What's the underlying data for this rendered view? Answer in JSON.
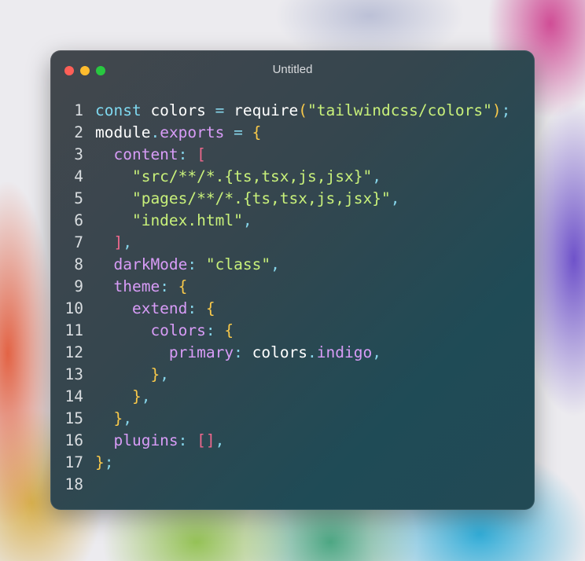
{
  "window": {
    "title": "Untitled",
    "controls": [
      "close-icon",
      "minimize-icon",
      "zoom-icon"
    ]
  },
  "colors": {
    "keyword": "#7fd9f0",
    "identifier": "#ffffff",
    "property": "#d89cf7",
    "punctuation": "#86d5ea",
    "brace": "#f9c94a",
    "bracket": "#f0688d",
    "string": "#c8f07a"
  },
  "code": {
    "lines": [
      {
        "num": "1",
        "tokens": [
          {
            "t": "const",
            "k": "kw"
          },
          {
            "t": " colors ",
            "k": "id"
          },
          {
            "t": "=",
            "k": "pc"
          },
          {
            "t": " require",
            "k": "id"
          },
          {
            "t": "(",
            "k": "br"
          },
          {
            "t": "\"tailwindcss/colors\"",
            "k": "st"
          },
          {
            "t": ")",
            "k": "br"
          },
          {
            "t": ";",
            "k": "pc"
          }
        ]
      },
      {
        "num": "2",
        "tokens": [
          {
            "t": "module",
            "k": "id"
          },
          {
            "t": ".",
            "k": "pc"
          },
          {
            "t": "exports",
            "k": "pr"
          },
          {
            "t": " = ",
            "k": "pc"
          },
          {
            "t": "{",
            "k": "br"
          }
        ]
      },
      {
        "num": "3",
        "tokens": [
          {
            "t": "  content",
            "k": "pr"
          },
          {
            "t": ": ",
            "k": "pc"
          },
          {
            "t": "[",
            "k": "sb"
          }
        ]
      },
      {
        "num": "4",
        "tokens": [
          {
            "t": "    \"src/**/*.{ts,tsx,js,jsx}\"",
            "k": "st"
          },
          {
            "t": ",",
            "k": "pc"
          }
        ]
      },
      {
        "num": "5",
        "tokens": [
          {
            "t": "    \"pages/**/*.{ts,tsx,js,jsx}\"",
            "k": "st"
          },
          {
            "t": ",",
            "k": "pc"
          }
        ]
      },
      {
        "num": "6",
        "tokens": [
          {
            "t": "    \"index.html\"",
            "k": "st"
          },
          {
            "t": ",",
            "k": "pc"
          }
        ]
      },
      {
        "num": "7",
        "tokens": [
          {
            "t": "  ]",
            "k": "sb"
          },
          {
            "t": ",",
            "k": "pc"
          }
        ]
      },
      {
        "num": "8",
        "tokens": [
          {
            "t": "  darkMode",
            "k": "pr"
          },
          {
            "t": ": ",
            "k": "pc"
          },
          {
            "t": "\"class\"",
            "k": "st"
          },
          {
            "t": ",",
            "k": "pc"
          }
        ]
      },
      {
        "num": "9",
        "tokens": [
          {
            "t": "  theme",
            "k": "pr"
          },
          {
            "t": ": ",
            "k": "pc"
          },
          {
            "t": "{",
            "k": "br"
          }
        ]
      },
      {
        "num": "10",
        "tokens": [
          {
            "t": "    extend",
            "k": "pr"
          },
          {
            "t": ": ",
            "k": "pc"
          },
          {
            "t": "{",
            "k": "br"
          }
        ]
      },
      {
        "num": "11",
        "tokens": [
          {
            "t": "      colors",
            "k": "pr"
          },
          {
            "t": ": ",
            "k": "pc"
          },
          {
            "t": "{",
            "k": "br"
          }
        ]
      },
      {
        "num": "12",
        "tokens": [
          {
            "t": "        primary",
            "k": "pr"
          },
          {
            "t": ": ",
            "k": "pc"
          },
          {
            "t": "colors",
            "k": "id"
          },
          {
            "t": ".",
            "k": "pc"
          },
          {
            "t": "indigo",
            "k": "pr"
          },
          {
            "t": ",",
            "k": "pc"
          }
        ]
      },
      {
        "num": "13",
        "tokens": [
          {
            "t": "      }",
            "k": "br"
          },
          {
            "t": ",",
            "k": "pc"
          }
        ]
      },
      {
        "num": "14",
        "tokens": [
          {
            "t": "    }",
            "k": "br"
          },
          {
            "t": ",",
            "k": "pc"
          }
        ]
      },
      {
        "num": "15",
        "tokens": [
          {
            "t": "  }",
            "k": "br"
          },
          {
            "t": ",",
            "k": "pc"
          }
        ]
      },
      {
        "num": "16",
        "tokens": [
          {
            "t": "  plugins",
            "k": "pr"
          },
          {
            "t": ": ",
            "k": "pc"
          },
          {
            "t": "[]",
            "k": "sb"
          },
          {
            "t": ",",
            "k": "pc"
          }
        ]
      },
      {
        "num": "17",
        "tokens": [
          {
            "t": "}",
            "k": "br"
          },
          {
            "t": ";",
            "k": "pc"
          }
        ]
      },
      {
        "num": "18",
        "tokens": []
      }
    ]
  }
}
